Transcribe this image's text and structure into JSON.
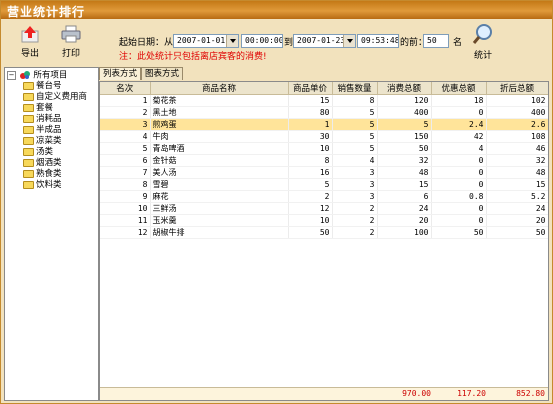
{
  "window": {
    "title": "营业统计排行"
  },
  "toolbar": {
    "export_label": "导出",
    "print_label": "打印",
    "stats_label": "统计"
  },
  "filter": {
    "start_label": "起始日期：从",
    "start_date": "2007-01-01",
    "start_time": "00:00:00",
    "to_label": "到",
    "end_date": "2007-01-23",
    "end_time": "09:53:48",
    "top_label": "的前：",
    "top_value": "50",
    "unit_label": "名",
    "notice": "注：此处统计只包括离店宾客的消费!"
  },
  "tree": {
    "root": "所有项目",
    "items": [
      "餐台号",
      "自定义费用商",
      "套餐",
      "消耗品",
      "半成品",
      "凉菜类",
      "汤类",
      "烟酒类",
      "熟食类",
      "饮料类"
    ]
  },
  "tabs": [
    {
      "label": "列表方式"
    },
    {
      "label": "图表方式"
    }
  ],
  "table": {
    "columns": [
      "名次",
      "商品名称",
      "商品单价",
      "销售数量",
      "消费总额",
      "优惠总额",
      "折后总额"
    ],
    "rows": [
      [
        "1",
        "菊花茶",
        "15",
        "8",
        "120",
        "18",
        "102"
      ],
      [
        "2",
        "黑土地",
        "80",
        "5",
        "400",
        "0",
        "400"
      ],
      [
        "3",
        "煎鸡蛋",
        "1",
        "5",
        "5",
        "2.4",
        "2.6"
      ],
      [
        "4",
        "牛肉",
        "30",
        "5",
        "150",
        "42",
        "108"
      ],
      [
        "5",
        "青岛啤酒",
        "10",
        "5",
        "50",
        "4",
        "46"
      ],
      [
        "6",
        "金针菇",
        "8",
        "4",
        "32",
        "0",
        "32"
      ],
      [
        "7",
        "美人汤",
        "16",
        "3",
        "48",
        "0",
        "48"
      ],
      [
        "8",
        "雪碧",
        "5",
        "3",
        "15",
        "0",
        "15"
      ],
      [
        "9",
        "麻花",
        "2",
        "3",
        "6",
        "0.8",
        "5.2"
      ],
      [
        "10",
        "三鲜汤",
        "12",
        "2",
        "24",
        "0",
        "24"
      ],
      [
        "11",
        "玉米羹",
        "10",
        "2",
        "20",
        "0",
        "20"
      ],
      [
        "12",
        "胡椒牛排",
        "50",
        "2",
        "100",
        "50",
        "50"
      ]
    ],
    "selected_row": 2,
    "totals": {
      "consume": "970.00",
      "discount": "117.20",
      "net": "852.80"
    }
  }
}
